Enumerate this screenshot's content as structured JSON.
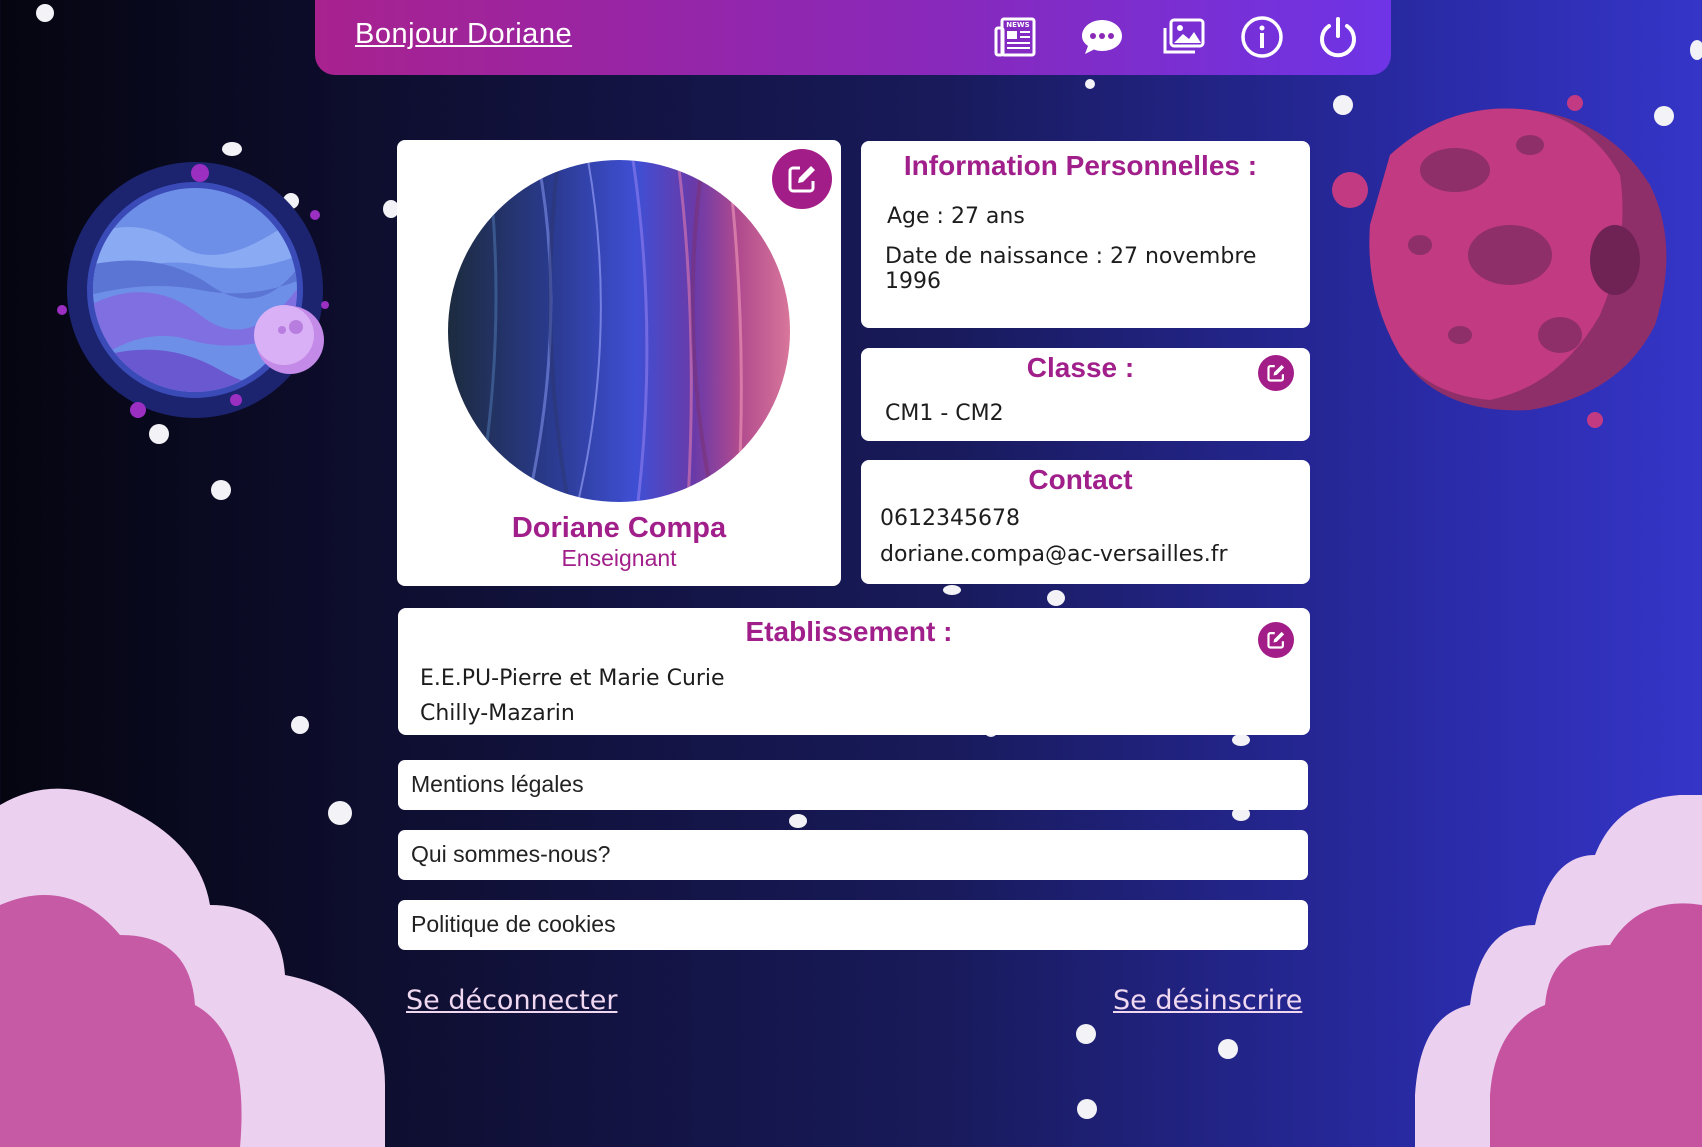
{
  "header": {
    "greeting": "Bonjour Doriane",
    "icons": [
      "news-icon",
      "chat-icon",
      "gallery-icon",
      "info-icon",
      "power-icon"
    ],
    "news_badge": "NEWS"
  },
  "profile": {
    "name": "Doriane Compa",
    "role": "Enseignant"
  },
  "personal_info": {
    "title": "Information Personnelles :",
    "age": "Age : 27 ans",
    "birthdate": "Date de naissance : 27 novembre 1996"
  },
  "classe": {
    "title": "Classe :",
    "value": "CM1 - CM2"
  },
  "contact": {
    "title": "Contact",
    "phone": "0612345678",
    "email": "doriane.compa@ac-versailles.fr"
  },
  "etablissement": {
    "title": "Etablissement :",
    "name": "E.E.PU-Pierre et Marie Curie",
    "city": "Chilly-Mazarin"
  },
  "menu": {
    "items": [
      "Mentions légales",
      "Qui sommes-nous?",
      "Politique de cookies"
    ]
  },
  "footer": {
    "logout": "Se déconnecter",
    "unsubscribe": "Se désinscrire"
  },
  "colors": {
    "accent": "#a01f8a",
    "header_start": "#a8228f",
    "header_end": "#6e34e6"
  }
}
